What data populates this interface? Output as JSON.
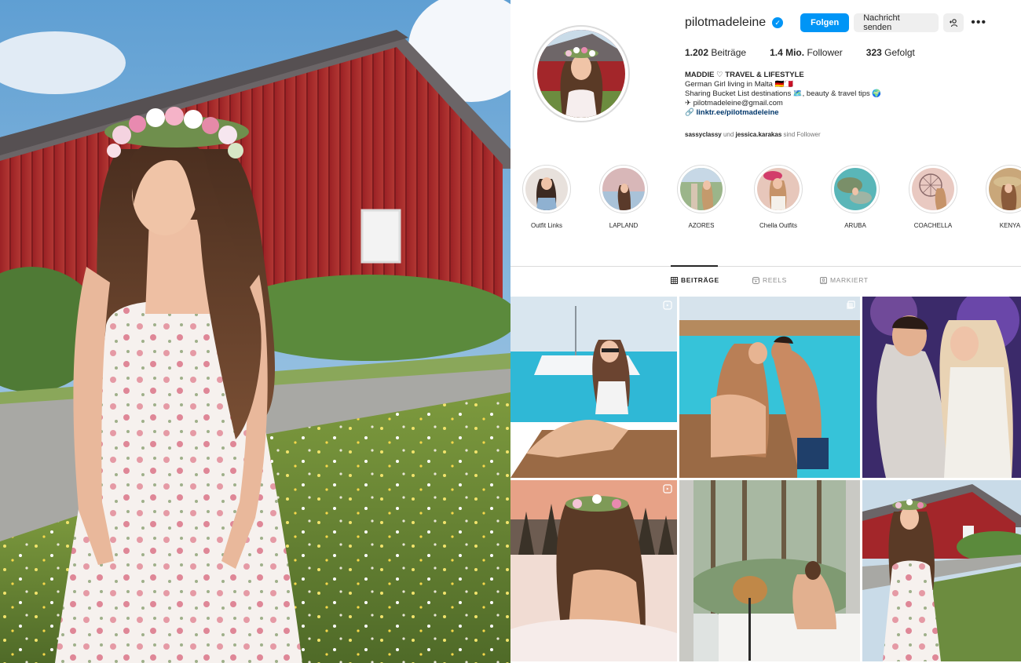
{
  "profile": {
    "username": "pilotmadeleine",
    "follow_label": "Folgen",
    "message_label": "Nachricht senden",
    "stats": {
      "posts_count": "1.202",
      "posts_label": "Beiträge",
      "followers_count": "1.4 Mio.",
      "followers_label": "Follower",
      "following_count": "323",
      "following_label": "Gefolgt"
    },
    "bio": {
      "name": "MADDIE ♡ TRAVEL & LIFESTYLE",
      "line1": "German Girl living in Malta 🇩🇪🇲🇹",
      "line2": "Sharing Bucket List destinations 🗺️, beauty & travel tips 🌍",
      "email": "✈ pilotmadeleine@gmail.com",
      "link": "linktr.ee/pilotmadeleine"
    },
    "followed_by": {
      "user1": "sassyclassy",
      "conj": "und",
      "user2": "jessica.karakas",
      "suffix": "sind Follower"
    }
  },
  "highlights": [
    {
      "label": "Outfit Links"
    },
    {
      "label": "LAPLAND"
    },
    {
      "label": "AZORES"
    },
    {
      "label": "Chella Outfits"
    },
    {
      "label": "ARUBA"
    },
    {
      "label": "COACHELLA"
    },
    {
      "label": "KENYA"
    }
  ],
  "tabs": [
    {
      "label": "BEITRÄGE",
      "active": true
    },
    {
      "label": "REELS",
      "active": false
    },
    {
      "label": "MARKIERT",
      "active": false
    }
  ],
  "colors": {
    "accent": "#0095f6",
    "barn_red": "#a3262a",
    "sea": "#2fb8d6"
  }
}
